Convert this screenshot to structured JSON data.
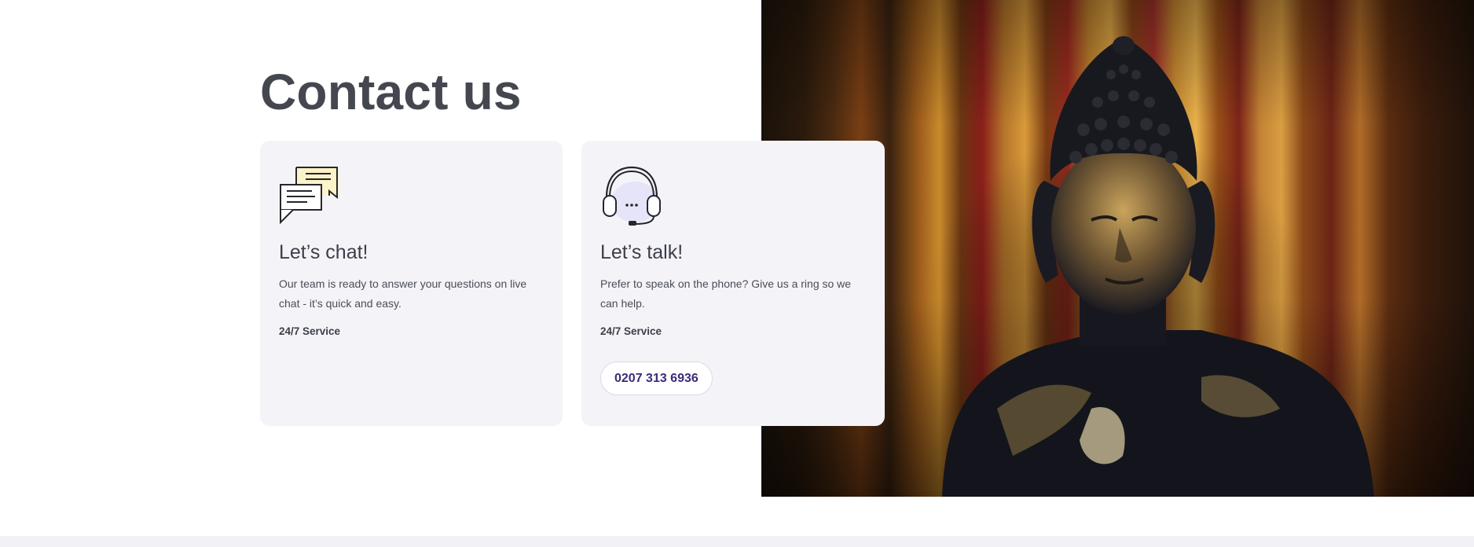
{
  "page": {
    "title": "Contact us"
  },
  "cards": {
    "chat": {
      "icon": "chat-bubbles-icon",
      "heading": "Let’s chat!",
      "description": "Our team is ready to answer your questions on live chat - it’s quick and easy.",
      "service": "24/7 Service"
    },
    "talk": {
      "icon": "headset-icon",
      "heading": "Let’s talk!",
      "description": "Prefer to speak on the phone? Give us a ring so we can help.",
      "service": "24/7 Service",
      "phone_label": "0207 313 6936"
    }
  },
  "image": {
    "subject": "buddha-statue-photo"
  },
  "colors": {
    "card_bg": "#f4f4f8",
    "title": "#454750",
    "accent": "#3d2a78",
    "icon_highlight": "#fdf3c8",
    "headset_highlight": "#e6e4f8"
  }
}
